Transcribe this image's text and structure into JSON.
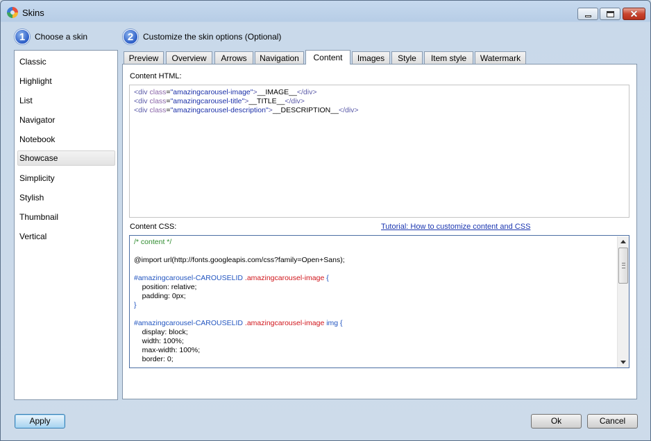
{
  "window": {
    "title": "Skins"
  },
  "steps": [
    {
      "number": "1",
      "label": "Choose a skin"
    },
    {
      "number": "2",
      "label": "Customize the skin options (Optional)"
    }
  ],
  "skins": [
    "Classic",
    "Highlight",
    "List",
    "Navigator",
    "Notebook",
    "Showcase",
    "Simplicity",
    "Stylish",
    "Thumbnail",
    "Vertical"
  ],
  "selected_skin": "Showcase",
  "tabs": [
    "Preview",
    "Overview",
    "Arrows",
    "Navigation",
    "Content",
    "Images",
    "Style",
    "Item style",
    "Watermark"
  ],
  "active_tab": "Content",
  "content": {
    "html_label": "Content HTML:",
    "css_label": "Content CSS:",
    "tutorial_link": "Tutorial: How to customize content and CSS",
    "html_lines": [
      "<div class=\"amazingcarousel-image\">__IMAGE__</div>",
      "<div class=\"amazingcarousel-title\">__TITLE__</div>",
      "<div class=\"amazingcarousel-description\">__DESCRIPTION__</div>"
    ],
    "css_lines": [
      "/* content */",
      "",
      "@import url(http://fonts.googleapis.com/css?family=Open+Sans);",
      "",
      "#amazingcarousel-CAROUSELID .amazingcarousel-image {",
      "    position: relative;",
      "    padding: 0px;",
      "}",
      "",
      "#amazingcarousel-CAROUSELID .amazingcarousel-image img {",
      "    display: block;",
      "    width: 100%;",
      "    max-width: 100%;",
      "    border: 0;"
    ]
  },
  "buttons": {
    "apply": "Apply",
    "ok": "Ok",
    "cancel": "Cancel"
  }
}
